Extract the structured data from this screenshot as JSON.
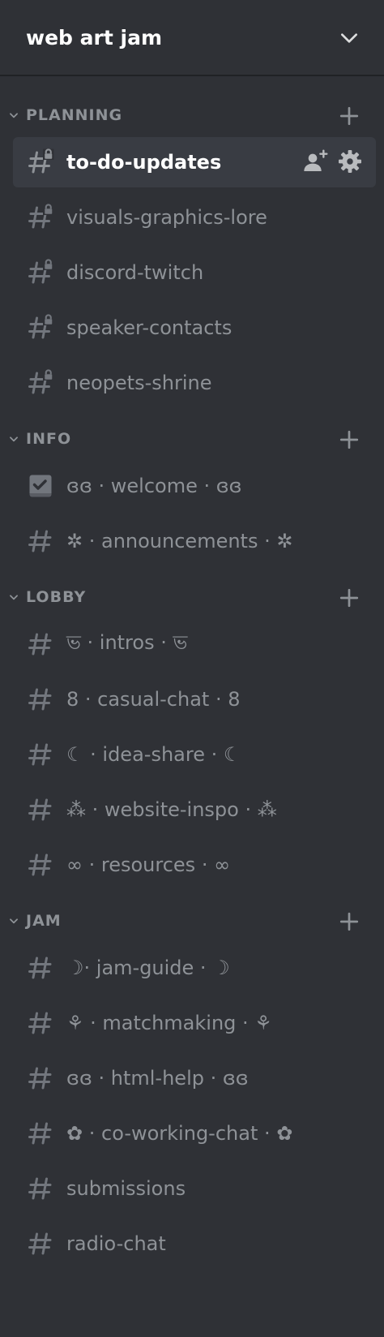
{
  "server": {
    "name": "web art jam"
  },
  "categories": [
    {
      "name": "PLANNING",
      "channels": [
        {
          "label": "to-do-updates",
          "icon": "hash-lock-icon",
          "selected": true
        },
        {
          "label": "visuals-graphics-lore",
          "icon": "hash-lock-icon"
        },
        {
          "label": "discord-twitch",
          "icon": "hash-lock-icon"
        },
        {
          "label": "speaker-contacts",
          "icon": "hash-lock-icon"
        },
        {
          "label": "neopets-shrine",
          "icon": "hash-lock-icon"
        }
      ]
    },
    {
      "name": "INFO",
      "channels": [
        {
          "label": "ɞɞ · welcome · ɞɞ",
          "icon": "rules-icon"
        },
        {
          "label": "✲ · announcements · ✲",
          "icon": "hash-icon"
        }
      ]
    },
    {
      "name": "LOBBY",
      "channels": [
        {
          "label": "ভ · intros · ভ",
          "icon": "hash-icon"
        },
        {
          "label": "8 · casual-chat · 8",
          "icon": "hash-icon"
        },
        {
          "label": "☾ · idea-share · ☾",
          "icon": "hash-icon"
        },
        {
          "label": "⁂ · website-inspo · ⁂",
          "icon": "hash-icon"
        },
        {
          "label": "∞ · resources · ∞",
          "icon": "hash-icon"
        }
      ]
    },
    {
      "name": "JAM",
      "channels": [
        {
          "label": "☽·  jam-guide · ☽",
          "icon": "hash-icon"
        },
        {
          "label": "⚘ · matchmaking · ⚘",
          "icon": "hash-icon"
        },
        {
          "label": "ɞɞ · html-help · ɞɞ",
          "icon": "hash-icon"
        },
        {
          "label": "✿ · co-working-chat · ✿",
          "icon": "hash-icon"
        },
        {
          "label": "submissions",
          "icon": "hash-icon"
        },
        {
          "label": "radio-chat",
          "icon": "hash-icon"
        }
      ]
    }
  ]
}
